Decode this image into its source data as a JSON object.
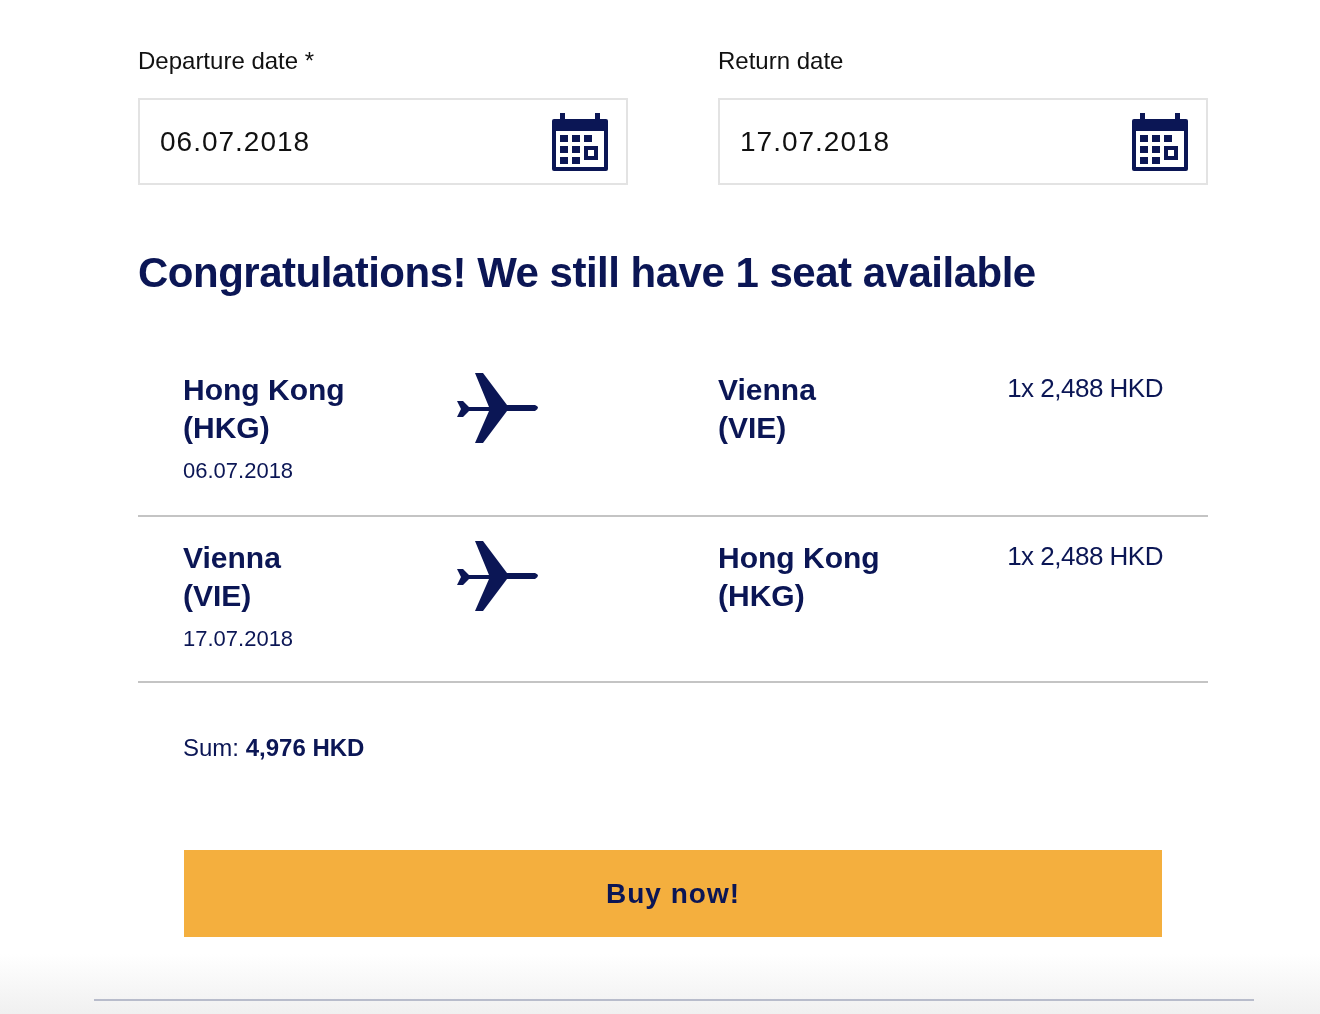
{
  "dates": [
    {
      "label": "Departure date *",
      "value": "06.07.2018"
    },
    {
      "label": "Return date",
      "value": "17.07.2018"
    }
  ],
  "heading": "Congratulations! We still have 1 seat available",
  "flights": [
    {
      "from_city": "Hong Kong",
      "from_code": "(HKG)",
      "date": "06.07.2018",
      "to_city": "Vienna",
      "to_code": "(VIE)",
      "price": "1x 2,488 HKD"
    },
    {
      "from_city": "Vienna",
      "from_code": "(VIE)",
      "date": "17.07.2018",
      "to_city": "Hong Kong",
      "to_code": "(HKG)",
      "price": "1x 2,488 HKD"
    }
  ],
  "sum": {
    "label": "Sum:",
    "value": "4,976 HKD"
  },
  "buy_button": "Buy now!"
}
